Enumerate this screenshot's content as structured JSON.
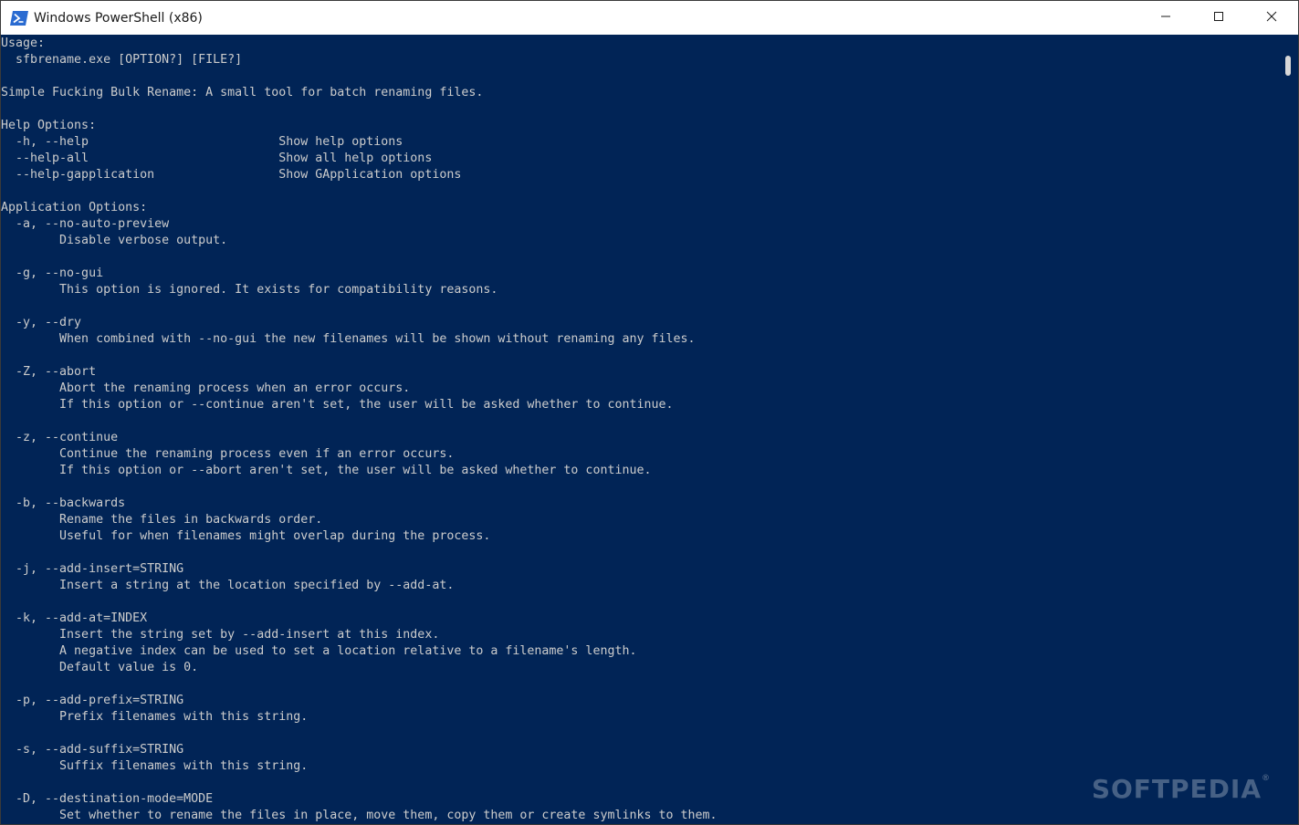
{
  "window": {
    "title": "Windows PowerShell (x86)",
    "accent": "#012456",
    "text_color": "#cccccc"
  },
  "icons": {
    "app": "powershell-icon",
    "minimize": "minimize-icon",
    "maximize": "maximize-icon",
    "close": "close-icon"
  },
  "console": {
    "lines": [
      "Usage:",
      "  sfbrename.exe [OPTION?] [FILE?]",
      "",
      "Simple Fucking Bulk Rename: A small tool for batch renaming files.",
      "",
      "Help Options:",
      "  -h, --help                          Show help options",
      "  --help-all                          Show all help options",
      "  --help-gapplication                 Show GApplication options",
      "",
      "Application Options:",
      "  -a, --no-auto-preview",
      "        Disable verbose output.",
      "",
      "  -g, --no-gui",
      "        This option is ignored. It exists for compatibility reasons.",
      "",
      "  -y, --dry",
      "        When combined with --no-gui the new filenames will be shown without renaming any files.",
      "",
      "  -Z, --abort",
      "        Abort the renaming process when an error occurs.",
      "        If this option or --continue aren't set, the user will be asked whether to continue.",
      "",
      "  -z, --continue",
      "        Continue the renaming process even if an error occurs.",
      "        If this option or --abort aren't set, the user will be asked whether to continue.",
      "",
      "  -b, --backwards",
      "        Rename the files in backwards order.",
      "        Useful for when filenames might overlap during the process.",
      "",
      "  -j, --add-insert=STRING",
      "        Insert a string at the location specified by --add-at.",
      "",
      "  -k, --add-at=INDEX",
      "        Insert the string set by --add-insert at this index.",
      "        A negative index can be used to set a location relative to a filename's length.",
      "        Default value is 0.",
      "",
      "  -p, --add-prefix=STRING",
      "        Prefix filenames with this string.",
      "",
      "  -s, --add-suffix=STRING",
      "        Suffix filenames with this string.",
      "",
      "  -D, --destination-mode=MODE",
      "        Set whether to rename the files in place, move them, copy them or create symlinks to them."
    ]
  },
  "watermark": {
    "text": "SOFTPEDIA",
    "mark": "®"
  }
}
